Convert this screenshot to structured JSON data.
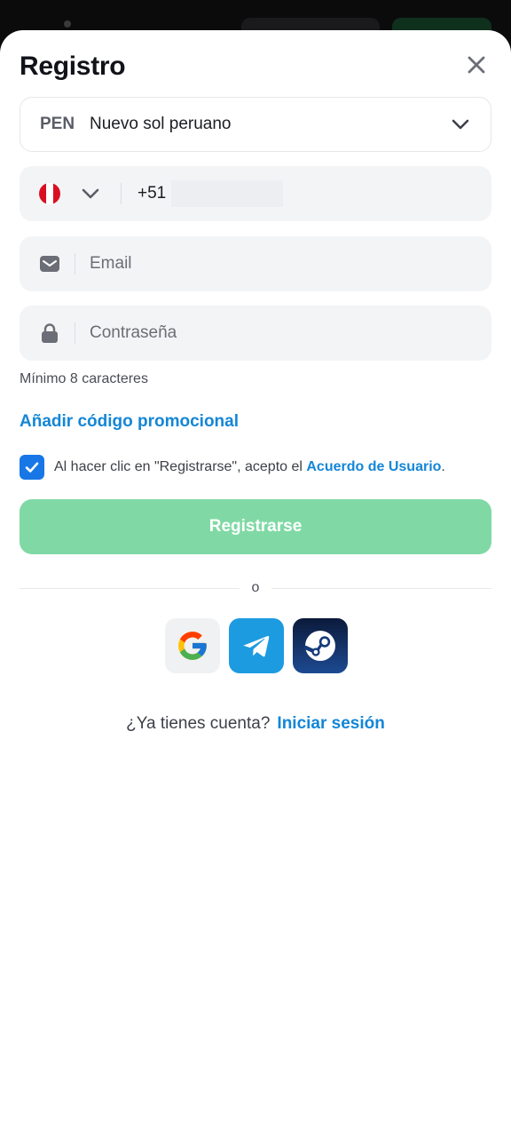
{
  "header": {
    "title": "Registro"
  },
  "currency": {
    "code": "PEN",
    "name": "Nuevo sol peruano"
  },
  "phone": {
    "country_icon": "peru-flag-icon",
    "dial_code": "+51",
    "value": ""
  },
  "email": {
    "placeholder": "Email",
    "value": ""
  },
  "password": {
    "placeholder": "Contraseña",
    "value": "",
    "hint": "Mínimo 8 caracteres"
  },
  "promo": {
    "label": "Añadir código promocional"
  },
  "agreement": {
    "checked": true,
    "text": "Al hacer clic en \"Registrarse\", acepto el ",
    "link_label": "Acuerdo de Usuario",
    "suffix": "."
  },
  "submit": {
    "label": "Registrarse"
  },
  "divider": {
    "label": "o"
  },
  "socials": {
    "items": [
      "google-icon",
      "telegram-icon",
      "steam-icon"
    ]
  },
  "login": {
    "prompt": "¿Ya tienes cuenta?",
    "link_label": "Iniciar sesión"
  },
  "colors": {
    "accent": "#1486d6",
    "submit_disabled": "#80d9a5",
    "checkbox": "#1777e6",
    "field_bg": "#f3f4f6"
  }
}
